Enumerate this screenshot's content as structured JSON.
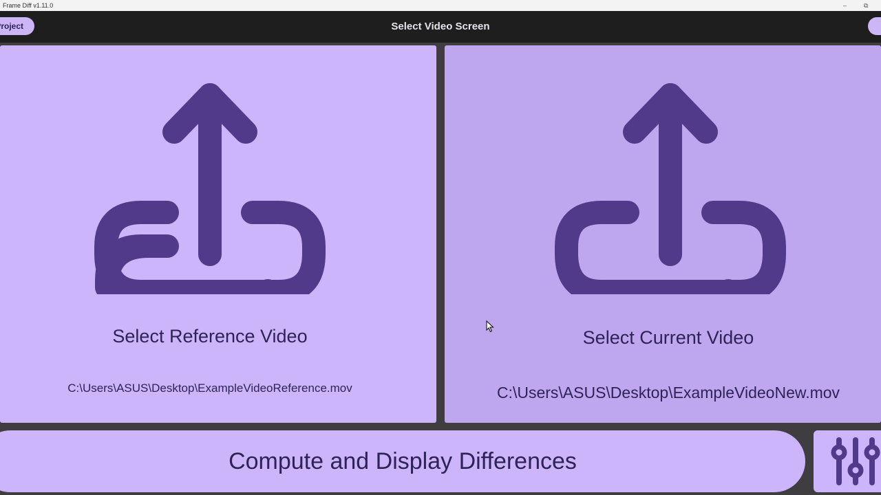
{
  "window": {
    "title": "Frame Diff v1.11.0",
    "minimize_glyph": "–",
    "restore_glyph": "⧉"
  },
  "header": {
    "title": "Select Video Screen",
    "left_button_label": "Project"
  },
  "reference_panel": {
    "icon": "upload-icon",
    "label": "Select Reference Video",
    "path": "C:\\Users\\ASUS\\Desktop\\ExampleVideoReference.mov"
  },
  "current_panel": {
    "icon": "upload-icon",
    "label": "Select Current Video",
    "path": "C:\\Users\\ASUS\\Desktop\\ExampleVideoNew.mov"
  },
  "compute_button": {
    "label": "Compute and Display Differences"
  },
  "settings_button": {
    "icon": "sliders-icon"
  },
  "colors": {
    "accent": "#cdb6f8",
    "panel_alt": "#bea7ee",
    "icon": "#523a8a",
    "text": "#2e2357",
    "header_bg": "#1f1e1f"
  }
}
